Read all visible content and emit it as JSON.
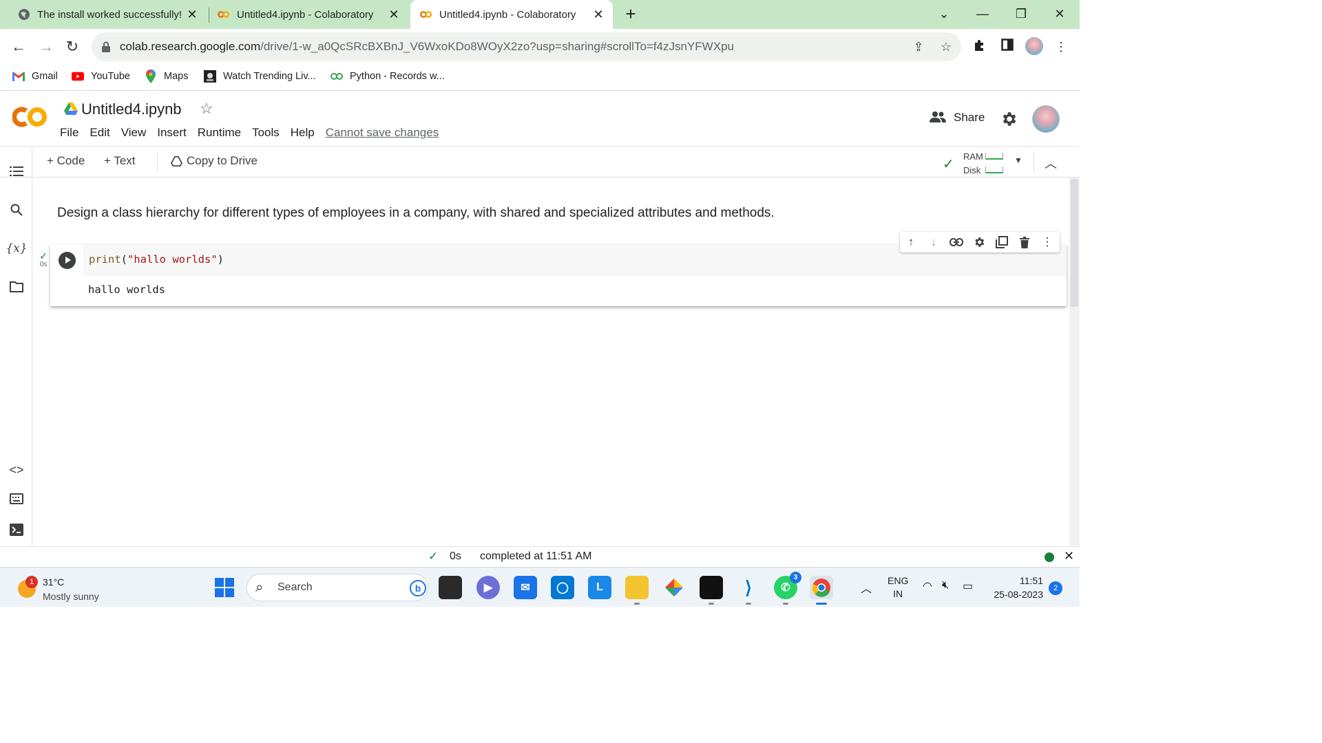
{
  "browser": {
    "tabs": [
      {
        "title": "The install worked successfully! C",
        "favicon": "globe-icon"
      },
      {
        "title": "Untitled4.ipynb - Colaboratory",
        "favicon": "colab-icon"
      },
      {
        "title": "Untitled4.ipynb - Colaboratory",
        "favicon": "colab-icon",
        "active": true
      }
    ],
    "url_host": "colab.research.google.com",
    "url_path": "/drive/1-w_a0QcSRcBXBnJ_V6WxoKDo8WOyX2zo?usp=sharing#scrollTo=f4zJsnYFWXpu",
    "bookmarks": [
      {
        "label": "Gmail",
        "icon": "gmail-icon"
      },
      {
        "label": "YouTube",
        "icon": "youtube-icon"
      },
      {
        "label": "Maps",
        "icon": "maps-icon"
      },
      {
        "label": "Watch Trending Liv...",
        "icon": "trending-icon"
      },
      {
        "label": "Python - Records w...",
        "icon": "python-records-icon"
      }
    ],
    "tab_strip_color": "#c5e7c5"
  },
  "colab": {
    "notebook_title": "Untitled4.ipynb",
    "menu": [
      "File",
      "Edit",
      "View",
      "Insert",
      "Runtime",
      "Tools",
      "Help"
    ],
    "cannot_save": "Cannot save changes",
    "share_label": "Share",
    "toolbar": {
      "code_label": "+ Code",
      "text_label": "+ Text",
      "copy_label": "Copy to Drive",
      "ram_label": "RAM",
      "disk_label": "Disk"
    },
    "text_cell": "Design a class hierarchy for different types of employees in a company, with shared and specialized attributes and methods.",
    "code_cell": {
      "fn": "print",
      "open": "(",
      "arg": "\"hallo worlds\"",
      "close": ")",
      "output": "hallo worlds",
      "exec_time": "0s"
    },
    "status": {
      "time": "0s",
      "completed": "completed at 11:51 AM"
    },
    "accent": "#f9ab00"
  },
  "taskbar": {
    "weather_temp": "31°C",
    "weather_cond": "Mostly sunny",
    "weather_badge": "1",
    "search_label": "Search",
    "whatsapp_badge": "3",
    "lang_line1": "ENG",
    "lang_line2": "IN",
    "time": "11:51",
    "date": "25-08-2023",
    "notifications": "2"
  }
}
